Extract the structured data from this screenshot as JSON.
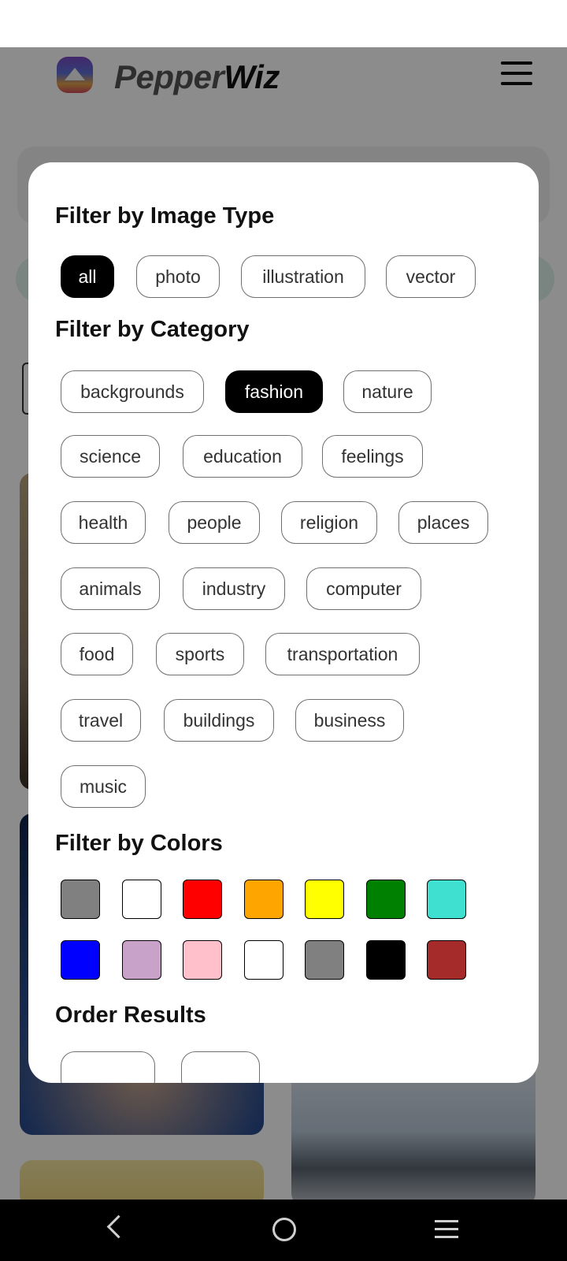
{
  "app": {
    "brand_part1": "Pepper",
    "brand_part2": "Wiz"
  },
  "filters": {
    "image_type_title": "Filter by Image Type",
    "image_types": [
      "all",
      "photo",
      "illustration",
      "vector"
    ],
    "selected_image_type": "all",
    "category_title": "Filter by Category",
    "categories": [
      "backgrounds",
      "fashion",
      "nature",
      "science",
      "education",
      "feelings",
      "health",
      "people",
      "religion",
      "places",
      "animals",
      "industry",
      "computer",
      "food",
      "sports",
      "transportation",
      "travel",
      "buildings",
      "business",
      "music"
    ],
    "selected_category": "fashion",
    "colors_title": "Filter by Colors",
    "colors": [
      "#808080",
      "#FFFFFF",
      "#FF0000",
      "#FFA500",
      "#FFFF00",
      "#008000",
      "#40E0D0",
      "#0000FF",
      "#C8A2C8",
      "#FFC0CB",
      "#FFFFFF",
      "#808080",
      "#000000",
      "#A52A2A"
    ],
    "order_title": "Order Results"
  },
  "icons": {
    "menu": "hamburger-menu-icon",
    "nav_back": "back-icon",
    "nav_home": "home-icon",
    "nav_recent": "recent-apps-icon"
  },
  "accent": {
    "selected_chip": "#000000",
    "overlay": "rgba(0,0,0,0.45)"
  }
}
